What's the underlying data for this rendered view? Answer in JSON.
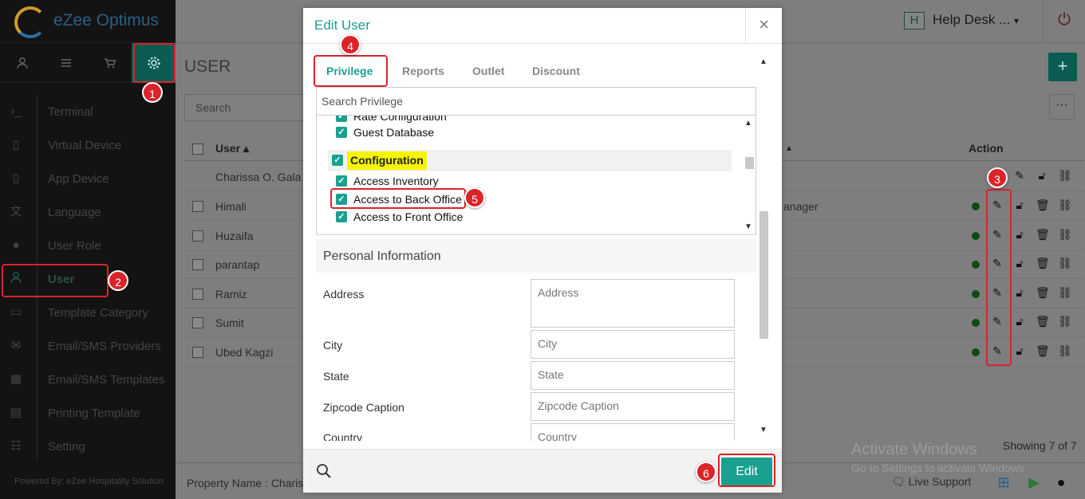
{
  "app": {
    "logo_text": "eZee Optimus",
    "powered_by": "Powered By: eZee Hospitality Solution"
  },
  "header": {
    "property_badge": "H",
    "account_label": "Help Desk ...",
    "account_caret": "▾"
  },
  "sidebar": {
    "top_icons": [
      {
        "icon": "user-icon"
      },
      {
        "icon": "list-icon"
      },
      {
        "icon": "cart-icon"
      },
      {
        "icon": "gear-icon",
        "active": true
      }
    ],
    "items": [
      {
        "label": "Terminal",
        "icon": "terminal-icon"
      },
      {
        "label": "Virtual Device",
        "icon": "tablet-icon"
      },
      {
        "label": "App Device",
        "icon": "mobile-icon"
      },
      {
        "label": "Language",
        "icon": "language-icon"
      },
      {
        "label": "User Role",
        "icon": "user-role-icon"
      },
      {
        "label": "User",
        "icon": "user-icon",
        "active": true
      },
      {
        "label": "Template Category",
        "icon": "inbox-icon"
      },
      {
        "label": "Email/SMS Providers",
        "icon": "envelope-icon"
      },
      {
        "label": "Email/SMS Templates",
        "icon": "calendar-icon"
      },
      {
        "label": "Printing Template",
        "icon": "document-icon"
      },
      {
        "label": "Setting",
        "icon": "sliders-icon"
      }
    ]
  },
  "page": {
    "title": "USER",
    "search_placeholder": "Search",
    "add_label": "+",
    "more_label": "···",
    "columns": {
      "user": "User ▴",
      "role_sort": "▴",
      "action": "Action"
    },
    "rows": [
      {
        "name": "Charissa O. Gala",
        "role": "",
        "status": false
      },
      {
        "name": "Himali",
        "role": "anager",
        "status": true
      },
      {
        "name": "Huzaifa",
        "role": "",
        "status": true
      },
      {
        "name": "parantap",
        "role": "",
        "status": true
      },
      {
        "name": "Ramiz",
        "role": "",
        "status": true
      },
      {
        "name": "Sumit",
        "role": "",
        "status": true
      },
      {
        "name": "Ubed Kagzi",
        "role": "",
        "status": true
      }
    ],
    "showing": "Showing 7 of 7",
    "footer_property": "Property Name : Charis",
    "live_support": "Live Support"
  },
  "windows_watermark": {
    "line1": "Activate Windows",
    "line2": "Go to Settings to activate Windows."
  },
  "modal": {
    "title": "Edit User",
    "close": "×",
    "tabs": [
      "Privilege",
      "Reports",
      "Outlet",
      "Discount"
    ],
    "privilege_search_placeholder": "Search Privilege",
    "privileges": {
      "partial_top": "Rate Configuration",
      "guest_database": "Guest Database",
      "configuration": "Configuration",
      "access_inventory": "Access Inventory",
      "access_back_office": "Access to Back Office",
      "access_front_office": "Access to Front Office"
    },
    "section_title": "Personal Information",
    "fields": [
      {
        "label": "Address",
        "placeholder": "Address"
      },
      {
        "label": "City",
        "placeholder": "City"
      },
      {
        "label": "State",
        "placeholder": "State"
      },
      {
        "label": "Zipcode Caption",
        "placeholder": "Zipcode Caption"
      },
      {
        "label": "Country",
        "placeholder": "Country"
      }
    ],
    "edit_button": "Edit"
  },
  "annotations": [
    "1",
    "2",
    "3",
    "4",
    "5",
    "6"
  ],
  "colors": {
    "accent": "#1aa08f",
    "annotation": "#d9242a",
    "sidebar_bg": "#131313",
    "overlay": "#7e7e7e"
  }
}
